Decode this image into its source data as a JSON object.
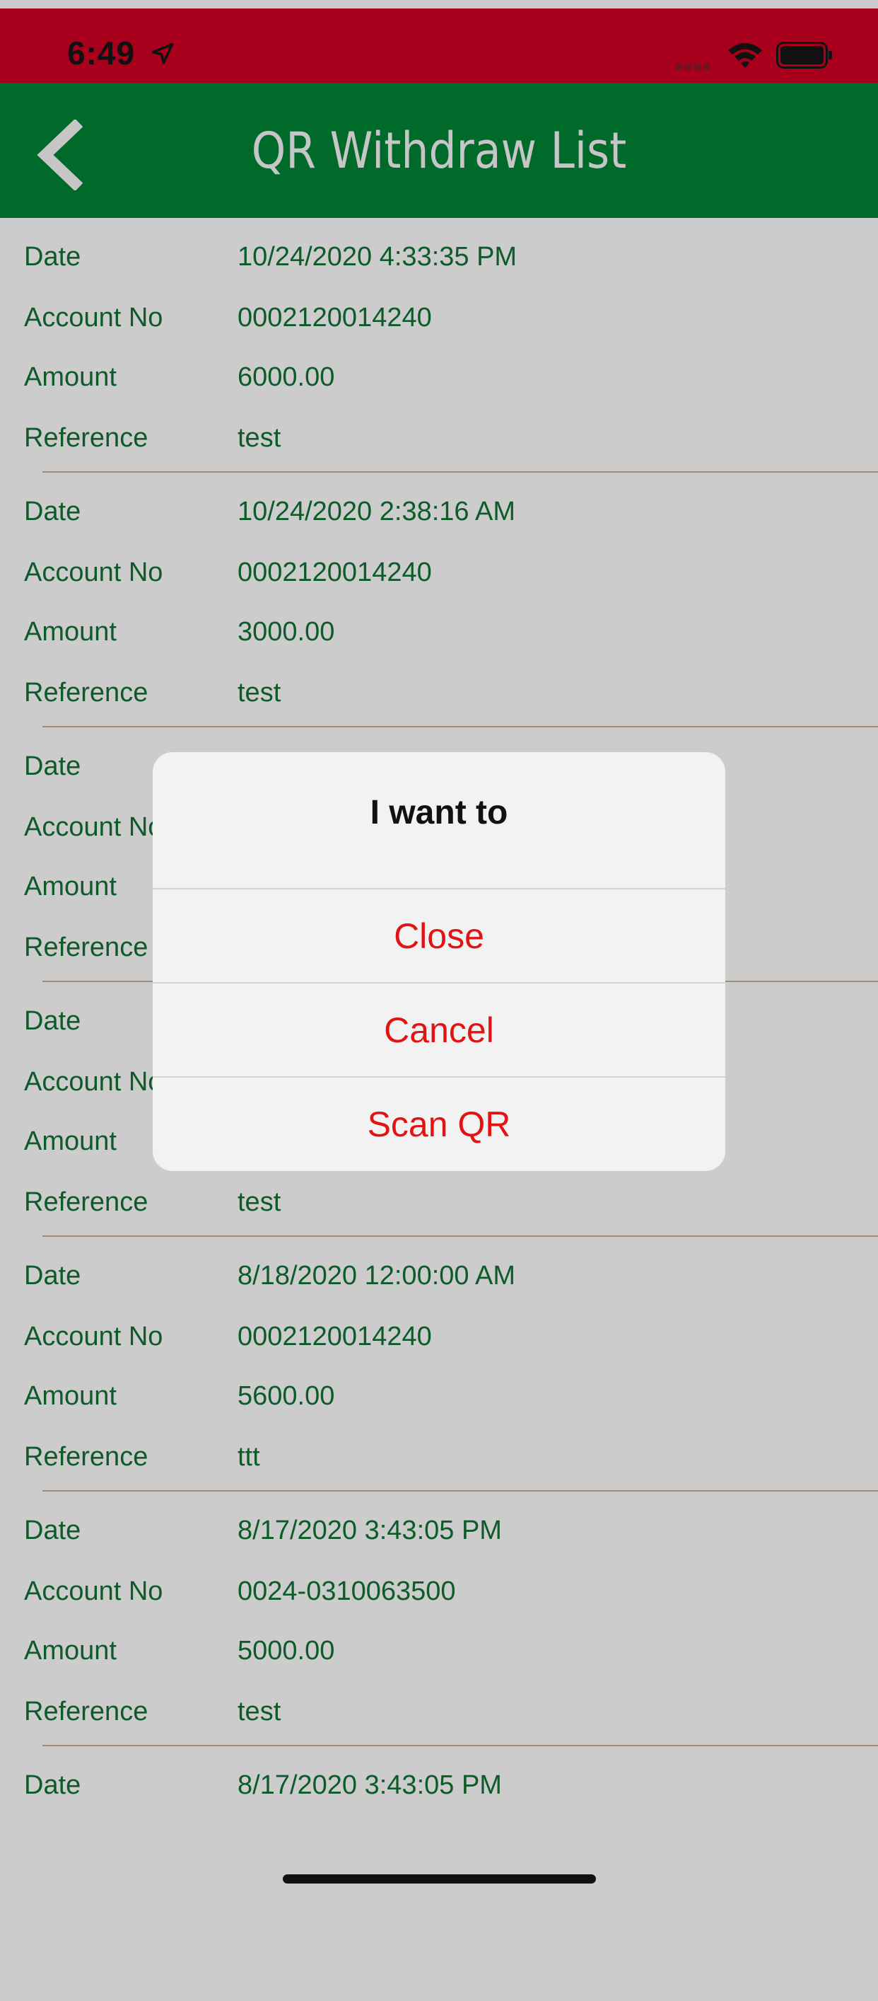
{
  "status_bar": {
    "time": "6:49",
    "accent": "#a8001c"
  },
  "nav": {
    "title": "QR Withdraw List",
    "back_icon": "chevron-left-icon",
    "accent": "#006a2a"
  },
  "records": [
    {
      "date_label": "Date",
      "date": "10/24/2020 4:33:35 PM",
      "account_label": "Account No",
      "account": "0002120014240",
      "amount_label": "Amount",
      "amount": "6000.00",
      "reference_label": "Reference",
      "reference": "test"
    },
    {
      "date_label": "Date",
      "date": "10/24/2020 2:38:16 AM",
      "account_label": "Account No",
      "account": "0002120014240",
      "amount_label": "Amount",
      "amount": "3000.00",
      "reference_label": "Reference",
      "reference": "test"
    },
    {
      "date_label": "Date",
      "date": "",
      "account_label": "Account No",
      "account": "",
      "amount_label": "Amount",
      "amount": "",
      "reference_label": "Reference",
      "reference": ""
    },
    {
      "date_label": "Date",
      "date": "",
      "account_label": "Account No",
      "account": "",
      "amount_label": "Amount",
      "amount": "",
      "reference_label": "Reference",
      "reference": "test"
    },
    {
      "date_label": "Date",
      "date": "8/18/2020 12:00:00 AM",
      "account_label": "Account No",
      "account": "0002120014240",
      "amount_label": "Amount",
      "amount": "5600.00",
      "reference_label": "Reference",
      "reference": "ttt"
    },
    {
      "date_label": "Date",
      "date": "8/17/2020 3:43:05 PM",
      "account_label": "Account No",
      "account": "0024-0310063500",
      "amount_label": "Amount",
      "amount": "5000.00",
      "reference_label": "Reference",
      "reference": "test"
    },
    {
      "date_label": "Date",
      "date": "8/17/2020 3:43:05 PM"
    }
  ],
  "alert": {
    "title": "I want to",
    "buttons": [
      "Close",
      "Cancel",
      "Scan QR"
    ],
    "button_color": "#e31313"
  }
}
